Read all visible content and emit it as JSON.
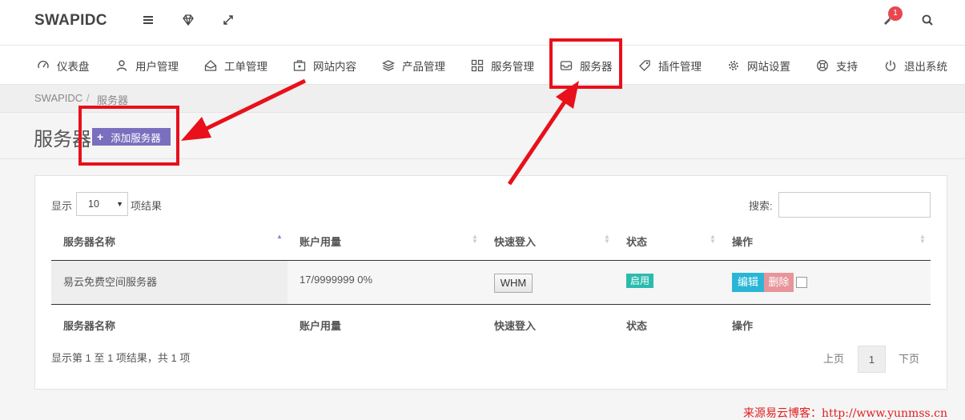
{
  "header": {
    "brand": "SWAPIDC",
    "notification_count": "1",
    "icons": [
      "menu-icon",
      "diamond-icon",
      "fullscreen-icon",
      "bell-icon",
      "search-icon"
    ]
  },
  "nav": {
    "items": [
      {
        "label": "仪表盘",
        "icon": "dashboard-icon"
      },
      {
        "label": "用户管理",
        "icon": "user-icon"
      },
      {
        "label": "工单管理",
        "icon": "ticket-icon"
      },
      {
        "label": "网站内容",
        "icon": "content-icon"
      },
      {
        "label": "产品管理",
        "icon": "layers-icon"
      },
      {
        "label": "服务管理",
        "icon": "grid-icon"
      },
      {
        "label": "服务器",
        "icon": "inbox-icon"
      },
      {
        "label": "插件管理",
        "icon": "tag-icon"
      },
      {
        "label": "网站设置",
        "icon": "gear-icon"
      },
      {
        "label": "支持",
        "icon": "support-icon"
      },
      {
        "label": "退出系统",
        "icon": "power-icon"
      }
    ]
  },
  "breadcrumb": {
    "home": "SWAPIDC",
    "sep": "/",
    "current": "服务器"
  },
  "page": {
    "title": "服务器",
    "add_button": "添加服务器"
  },
  "table": {
    "show_label": "显示",
    "page_length": "10",
    "results_label": "项结果",
    "search_label": "搜索:",
    "search_value": "",
    "columns": [
      "服务器名称",
      "账户用量",
      "快速登入",
      "状态",
      "操作"
    ],
    "rows": [
      {
        "name": "易云免费空间服务器",
        "usage": "17/9999999 0%",
        "login": "WHM",
        "status": "启用",
        "edit": "编辑",
        "delete": "删除"
      }
    ],
    "info": "显示第 1 至 1 项结果，共 1 项",
    "pagination": {
      "prev": "上页",
      "current": "1",
      "next": "下页"
    }
  },
  "annotation_color": "#e8101a",
  "watermark": "来源易云博客：http://www.yunmss.cn"
}
